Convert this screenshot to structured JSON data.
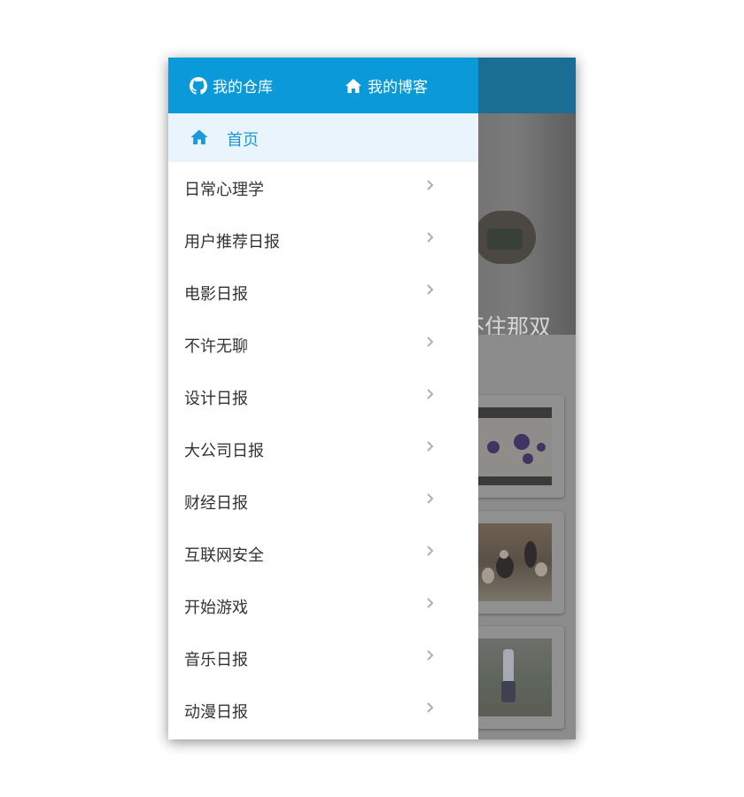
{
  "colors": {
    "drawer_header_bg": "#0a9ad9",
    "active_item_bg": "#eaf4fc",
    "active_item_text": "#1a9ad6",
    "menu_text": "#333333",
    "chevron": "#b0b0b0",
    "app_header_dimmed": "#1b6e93"
  },
  "drawer": {
    "header": {
      "repo_link": {
        "label": "我的仓库",
        "icon": "github-icon"
      },
      "blog_link": {
        "label": "我的博客",
        "icon": "home-icon"
      }
    },
    "active_item": {
      "label": "首页",
      "icon": "home-icon"
    },
    "menu_items": [
      {
        "label": "日常心理学"
      },
      {
        "label": "用户推荐日报"
      },
      {
        "label": "电影日报"
      },
      {
        "label": "不许无聊"
      },
      {
        "label": "设计日报"
      },
      {
        "label": "大公司日报"
      },
      {
        "label": "财经日报"
      },
      {
        "label": "互联网安全"
      },
      {
        "label": "开始游戏"
      },
      {
        "label": "音乐日报"
      },
      {
        "label": "动漫日报"
      }
    ],
    "chevron_icon": "chevron-right-icon"
  },
  "background_app": {
    "hero_title_partial": "不住那双"
  }
}
